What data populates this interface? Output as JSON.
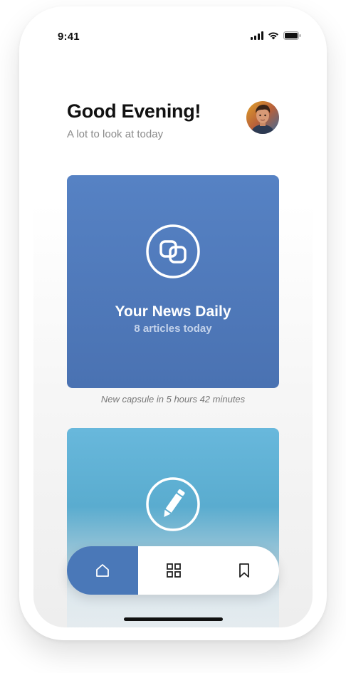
{
  "status_bar": {
    "time": "9:41"
  },
  "header": {
    "greeting": "Good Evening!",
    "subtitle": "A lot to look at today"
  },
  "cards": [
    {
      "title": "Your News Daily",
      "subtitle": "8 articles today",
      "icon": "capsule-icon",
      "color": "#4f7bbd"
    },
    {
      "title": "",
      "subtitle": "",
      "icon": "pencil-icon",
      "color": "#63b4d8"
    }
  ],
  "caption": "New capsule in 5 hours 42 minutes",
  "tabbar": {
    "items": [
      {
        "icon": "home-icon",
        "active": true
      },
      {
        "icon": "grid-icon",
        "active": false
      },
      {
        "icon": "bookmark-icon",
        "active": false
      }
    ],
    "active_color": "#4a78b8"
  }
}
